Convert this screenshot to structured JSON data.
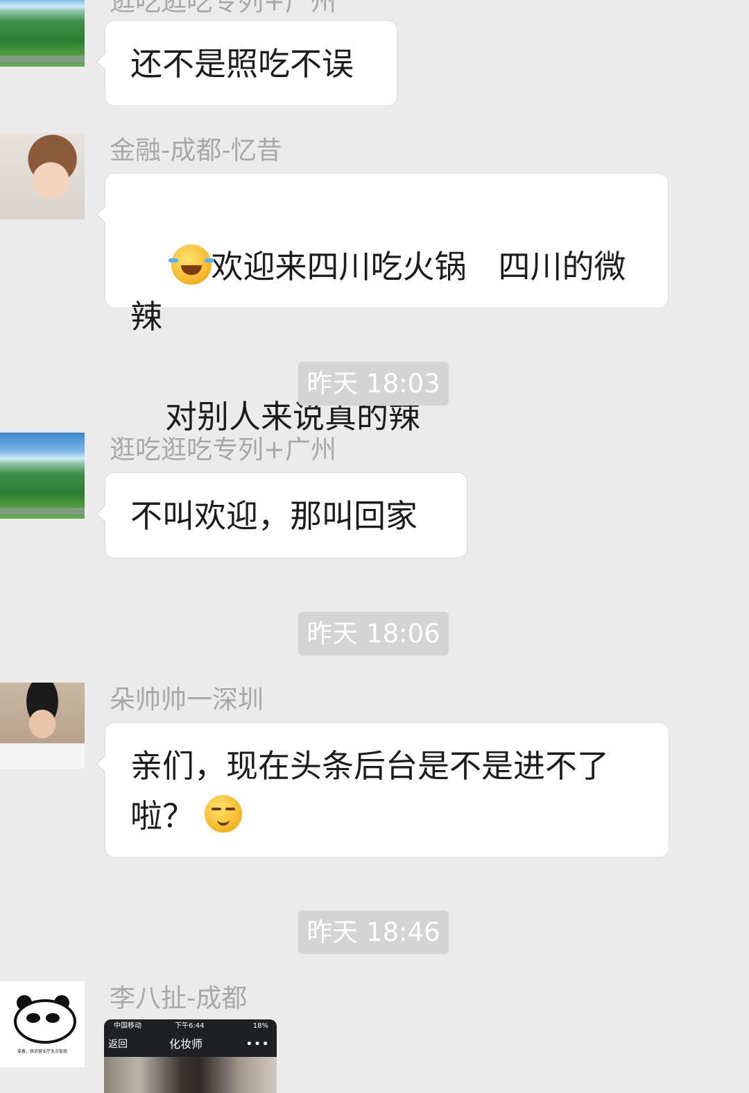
{
  "messages": [
    {
      "sender": "逛吃逛吃专列+广州",
      "text": "还不是照吃不误",
      "avatar_icon": "lotus-lake-avatar"
    },
    {
      "sender": "金融-成都-忆昔",
      "text_line1": "欢迎来四川吃火锅　四川的微辣",
      "text_line2": "对别人来说真的辣",
      "emoji": "laughing-tears-emoji",
      "avatar_icon": "girl-avatar"
    },
    {
      "sender": "逛吃逛吃专列+广州",
      "text": "不叫欢迎，那叫回家",
      "avatar_icon": "lotus-lake-avatar"
    },
    {
      "sender": "朵帅帅一深圳",
      "text_line1": "亲们，现在头条后台是不是进不了",
      "text_line2": "啦？",
      "emoji": "smirk-emoji",
      "avatar_icon": "man-avatar"
    },
    {
      "sender": "李八扯-成都",
      "avatar_icon": "panda-avatar",
      "avatar_caption": "拿着，快去营业厅充点智商"
    }
  ],
  "timestamps": [
    "昨天 18:03",
    "昨天 18:06",
    "昨天 18:46"
  ],
  "screenshot": {
    "carrier": "中国移动",
    "time": "下午6:44",
    "battery": "18%",
    "back": "返回",
    "title": "化妆师",
    "more": "•••"
  },
  "colors": {
    "background": "#ebebeb",
    "bubble": "#ffffff",
    "sender_name": "#a8a8a8",
    "time_pill": "#d4d4d4"
  }
}
